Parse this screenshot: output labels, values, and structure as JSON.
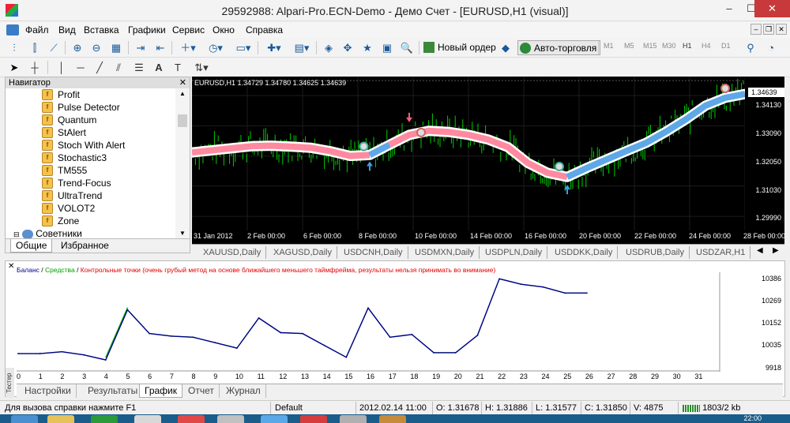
{
  "window": {
    "title": "29592988: Alpari-Pro.ECN-Demo - Демо Счет - [EURUSD,H1 (visual)]",
    "minimize": "–",
    "maximize": "☐",
    "close": "✕"
  },
  "menu": [
    "Файл",
    "Вид",
    "Вставка",
    "Графики",
    "Сервис",
    "Окно",
    "Справка"
  ],
  "toolbar": {
    "new_order": "Новый ордер",
    "auto_trading": "Авто-торговля",
    "timeframes": [
      "M1",
      "M5",
      "M15",
      "M30",
      "H1",
      "H4",
      "D1"
    ],
    "active_timeframe": "H1"
  },
  "navigator": {
    "title": "Навигатор",
    "items": [
      "Profit",
      "Pulse Detector",
      "Quantum",
      "StAlert",
      "Stoch With Alert",
      "Stochastic3",
      "TM555",
      "Trend-Focus",
      "UltraTrend",
      "VOLOT2",
      "Zone"
    ],
    "advisors_label": "Советники",
    "tabs": [
      "Общие",
      "Избранное"
    ]
  },
  "chart": {
    "header": "EURUSD,H1  1.34729 1.34780 1.34625 1.34639",
    "current_price": "1.34639",
    "price_labels": [
      "1.34130",
      "1.33090",
      "1.32050",
      "1.31030",
      "1.29990"
    ],
    "price_values": [
      1.3413,
      1.3309,
      1.3205,
      1.3103,
      1.2999
    ],
    "time_labels": [
      "31 Jan 2012",
      "2 Feb 00:00",
      "6 Feb 00:00",
      "8 Feb 00:00",
      "10 Feb 00:00",
      "14 Feb 00:00",
      "16 Feb 00:00",
      "20 Feb 00:00",
      "22 Feb 00:00",
      "24 Feb 00:00",
      "28 Feb 00:00"
    ],
    "colors": {
      "bg": "#000000",
      "candles": "#00cc00",
      "band_down": "#ff8aa0",
      "band_up": "#5fa8e8",
      "band_edge": "#ffffff"
    }
  },
  "symbol_tabs": [
    "XAUUSD,Daily",
    "XAGUSD,Daily",
    "USDCNH,Daily",
    "USDMXN,Daily",
    "USDPLN,Daily",
    "USDDKK,Daily",
    "USDRUB,Daily",
    "USDZAR,H1"
  ],
  "tester": {
    "legend_balance": "Баланс",
    "legend_sep1": " / ",
    "legend_equity": "Средства",
    "legend_sep2": " / ",
    "legend_points": "Контрольные точки (очень грубый метод на основе ближайшего меньшего таймфрейма, результаты нельзя принимать во внимание)",
    "side_label": "Тестер",
    "y_labels": [
      "10386",
      "10269",
      "10152",
      "10035",
      "9918"
    ],
    "x_labels": [
      "0",
      "1",
      "2",
      "3",
      "4",
      "5",
      "6",
      "7",
      "8",
      "9",
      "10",
      "11",
      "12",
      "13",
      "14",
      "15",
      "16",
      "17",
      "18",
      "19",
      "20",
      "21",
      "22",
      "23",
      "24",
      "25",
      "26",
      "27",
      "28",
      "29",
      "30",
      "31"
    ],
    "tabs": [
      "Настройки",
      "Результаты",
      "График",
      "Отчет",
      "Журнал"
    ],
    "active_tab": "График",
    "colors": {
      "balance": "#00008b",
      "equity": "#00a000",
      "points": "#e00000"
    }
  },
  "chart_data": {
    "type": "line",
    "title": "",
    "xlabel": "",
    "ylabel": "",
    "x": [
      0,
      1,
      2,
      3,
      4,
      5,
      6,
      7,
      8,
      9,
      10,
      11,
      12,
      13,
      14,
      15,
      16,
      17,
      18,
      19,
      20,
      21,
      22,
      23,
      24,
      25,
      26
    ],
    "series": [
      {
        "name": "Баланс",
        "values": [
          10000,
          10000,
          10010,
          9993,
          9965,
          10240,
          10110,
          10096,
          10090,
          10060,
          10030,
          10195,
          10115,
          10110,
          10045,
          9980,
          10250,
          10090,
          10105,
          10005,
          10005,
          10100,
          10410,
          10380,
          10365,
          10332,
          10332
        ]
      }
    ],
    "ylim": [
      9918,
      10420
    ],
    "xlim": [
      0,
      32
    ]
  },
  "status": {
    "help": "Для вызова справки нажмите F1",
    "profile": "Default",
    "datetime": "2012.02.14 11:00",
    "open": "O: 1.31678",
    "high": "H: 1.31886",
    "low": "L: 1.31577",
    "close": "C: 1.31850",
    "volume": "V: 4875",
    "traffic": "1803/2 kb"
  },
  "taskbar": {
    "time": "22:00"
  }
}
